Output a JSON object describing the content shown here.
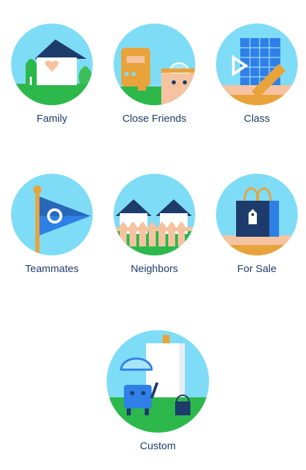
{
  "groups": [
    {
      "id": "family",
      "label": "Family",
      "icon": "house-heart-icon"
    },
    {
      "id": "close-friends",
      "label": "Close Friends",
      "icon": "friends-characters-icon"
    },
    {
      "id": "class",
      "label": "Class",
      "icon": "blueprint-ruler-icon"
    },
    {
      "id": "teammates",
      "label": "Teammates",
      "icon": "pennant-flag-icon"
    },
    {
      "id": "neighbors",
      "label": "Neighbors",
      "icon": "houses-fence-icon"
    },
    {
      "id": "for-sale",
      "label": "For Sale",
      "icon": "shopping-bag-tag-icon"
    },
    {
      "id": "custom",
      "label": "Custom",
      "icon": "robot-easel-paint-icon"
    }
  ],
  "colors": {
    "sky": "#7fdcf7",
    "grass": "#2db84b",
    "navy": "#1d3b6b",
    "blue": "#2f80e6",
    "orange": "#e8a33a",
    "peach": "#f6c3a1"
  }
}
